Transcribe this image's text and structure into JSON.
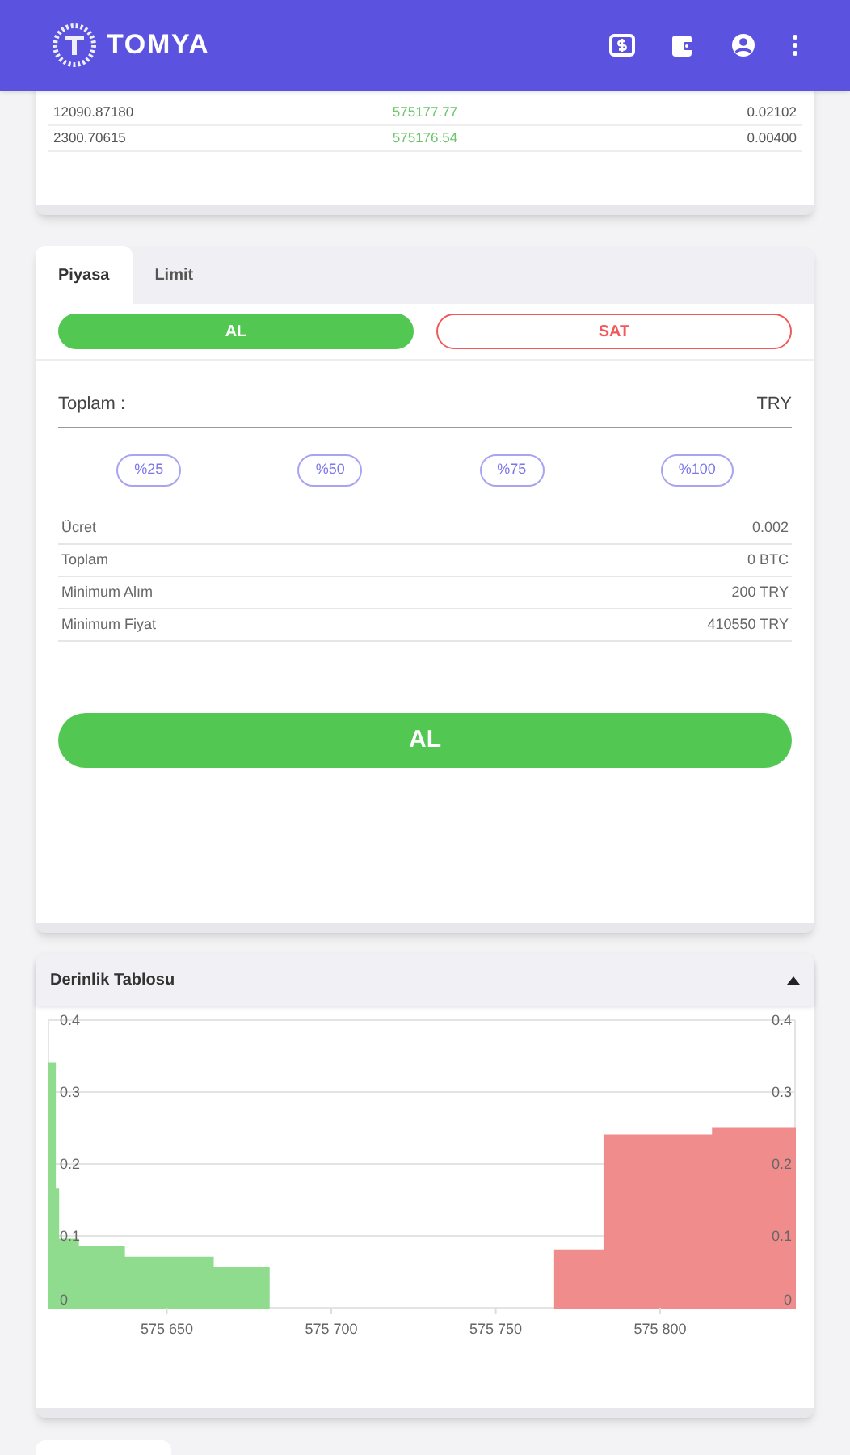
{
  "app_bar": {
    "brand": "TOMYA"
  },
  "trades": {
    "rows": [
      {
        "amount": "12090.87180",
        "price": "575177.77",
        "quantity": "0.02102"
      },
      {
        "amount": "2300.70615",
        "price": "575176.54",
        "quantity": "0.00400"
      }
    ]
  },
  "order_form": {
    "tabs": [
      {
        "label": "Piyasa",
        "selected": true
      },
      {
        "label": "Limit",
        "selected": false
      }
    ],
    "sides": [
      {
        "label": "AL",
        "kind": "buy",
        "selected": true
      },
      {
        "label": "SAT",
        "kind": "sell",
        "selected": false
      }
    ],
    "total_field": {
      "label": "Toplam :",
      "suffix": "TRY"
    },
    "percent_buttons": [
      "%25",
      "%50",
      "%75",
      "%100"
    ],
    "info_rows": [
      {
        "label": "Ücret",
        "value": "0.002"
      },
      {
        "label": "Toplam",
        "value": "0 BTC"
      },
      {
        "label": "Minimum Alım",
        "value": "200 TRY"
      },
      {
        "label": "Minimum Fiyat",
        "value": "410550 TRY"
      }
    ],
    "submit": "AL"
  },
  "depth_panel": {
    "title": "Derinlik Tablosu",
    "expanded": true,
    "chart_data": {
      "type": "area",
      "x": [
        575614,
        575616,
        575617,
        575623,
        575637,
        575664,
        575681,
        575768,
        575783,
        575816,
        575841
      ],
      "series": [
        {
          "color": "#8fdc8f",
          "values": [
            0.34,
            0.165,
            0.095,
            0.085,
            0.07,
            0.055,
            0.055,
            null,
            null,
            null,
            null
          ]
        },
        {
          "color": "#f08c8c",
          "values": [
            null,
            null,
            null,
            null,
            null,
            null,
            null,
            0.08,
            0.24,
            0.25,
            0.25
          ]
        }
      ],
      "xlim": [
        575614,
        575841
      ],
      "ylim": [
        0,
        0.4
      ],
      "xticks": [
        {
          "value": 575650,
          "label": "575 650"
        },
        {
          "value": 575700,
          "label": "575 700"
        },
        {
          "value": 575750,
          "label": "575 750"
        },
        {
          "value": 575800,
          "label": "575 800"
        }
      ],
      "yticks": [
        0,
        0.1,
        0.2,
        0.3,
        0.4
      ],
      "annotations": [
        "0",
        "0.1",
        "0.2",
        "0.3",
        "0.4"
      ],
      "grid": true
    }
  }
}
